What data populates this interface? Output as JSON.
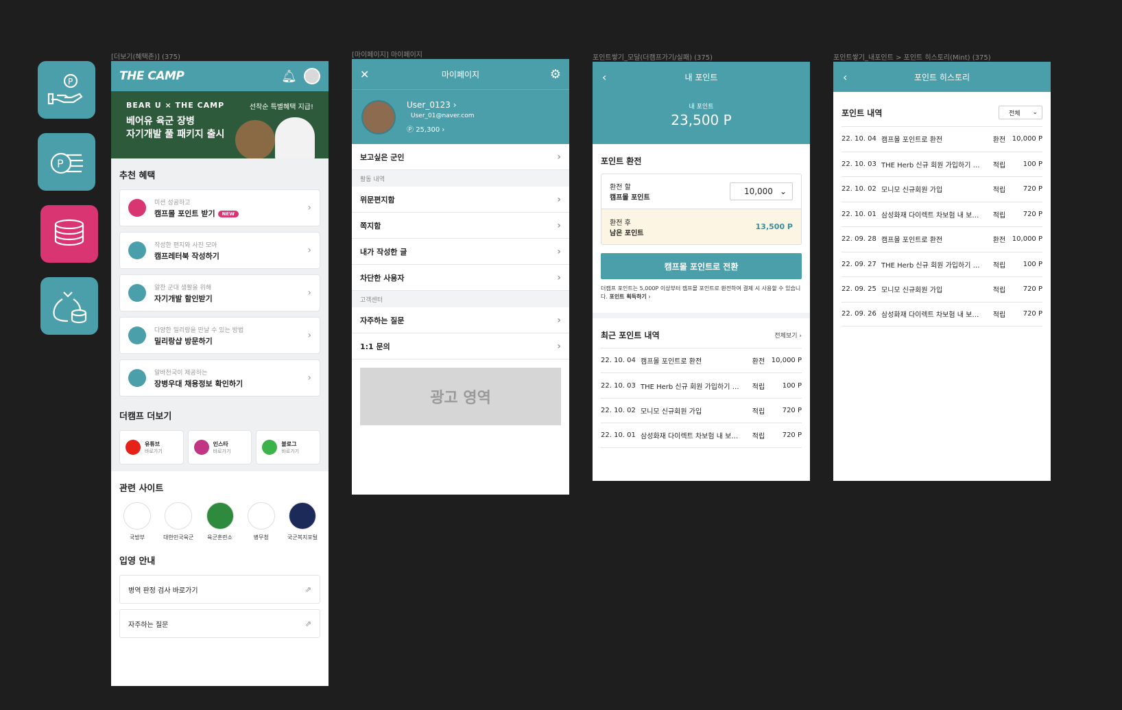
{
  "labels": {
    "s1": "[더보기(혜택존)] (375)",
    "s2": "[마이페이지] 마이페이지",
    "s3": "포인트쌓기_모달(더캠프가기/실패) (375)",
    "s4": "포인트쌓기_내포인트 > 포인트 히스토리(Mint) (375)"
  },
  "colors": {
    "teal": "#4a9fab",
    "pink": "#d93572",
    "bg": "#1e1e1e"
  },
  "tiles": [
    {
      "icon": "hand-point-icon",
      "color": "#4a9fab"
    },
    {
      "icon": "point-coins-icon",
      "color": "#4a9fab"
    },
    {
      "icon": "coin-stack-icon",
      "color": "#d93572"
    },
    {
      "icon": "money-bag-icon",
      "color": "#4a9fab"
    }
  ],
  "s1": {
    "logo": "THE CAMP",
    "banner": {
      "brand": "BEAR U × THE CAMP",
      "highlight": "선착순 특별혜택 지급!",
      "line1": "베어유 육군 장병",
      "line2": "자기개발 풀 패키지 출시"
    },
    "benefit_title": "추천 혜택",
    "benefits": [
      {
        "sub": "미션 성공하고",
        "main": "캠프몰 포인트 받기",
        "badge": "NEW"
      },
      {
        "sub": "작성한 편지와 사진 모아",
        "main": "캠프레터북 작성하기"
      },
      {
        "sub": "알찬 군대 생활을 위해",
        "main": "자기개발 할인받기"
      },
      {
        "sub": "다양한 밀리랑을 만날 수 있는 방법",
        "main": "밀리랑샵 방문하기"
      },
      {
        "sub": "알바천국이 제공하는",
        "main": "장병우대 채용정보 확인하기"
      }
    ],
    "more_title": "더캠프 더보기",
    "social": [
      {
        "name": "유튜브",
        "go": "바로가기",
        "color": "#e62117"
      },
      {
        "name": "인스타",
        "go": "바로가기",
        "color": "#c13584"
      },
      {
        "name": "블로그",
        "go": "바로가기",
        "color": "#3bb34a"
      }
    ],
    "sites_title": "관련 사이트",
    "sites": [
      {
        "name": "국방부",
        "color": "#ffffff"
      },
      {
        "name": "대한민국육군",
        "color": "#ffffff"
      },
      {
        "name": "육군훈련소",
        "color": "#2e8b3e"
      },
      {
        "name": "병무청",
        "color": "#ffffff"
      },
      {
        "name": "국군복지포털",
        "color": "#1c2a5a"
      }
    ],
    "enlist_title": "입영 안내",
    "links": [
      "병역 판정 검사 바로가기",
      "자주하는 질문"
    ]
  },
  "s2": {
    "title": "마이페이지",
    "user": "User_0123",
    "email": "User_01@naver.com",
    "points": "25,300",
    "menu_top": "보고싶은 군인",
    "group1": "활동 내역",
    "group1_items": [
      "위문편지함",
      "쪽지함",
      "내가 작성한 글",
      "차단한 사용자"
    ],
    "group2": "고객센터",
    "group2_items": [
      "자주하는 질문",
      "1:1 문의"
    ],
    "ad": "광고 영역"
  },
  "s3": {
    "title": "내 포인트",
    "my_label": "내 포인트",
    "my_value": "23,500 P",
    "exchange_title": "포인트 환전",
    "exchange_label1": "환전 할",
    "exchange_label2": "캠프몰 포인트",
    "exchange_value": "10,000",
    "remain_label1": "환전 후",
    "remain_label2": "남은 포인트",
    "remain_value": "13,500 P",
    "convert_button": "캠프몰 포인트로 전환",
    "note": "더캠프 포인트는 5,000P 이상부터 캠프몰 포인트로 환전하여 결제 시 사용할 수 있습니다.",
    "note_link": "포인트 획득하기",
    "recent_title": "최근 포인트 내역",
    "see_all": "전체보기",
    "history": [
      {
        "date": "22. 10. 04",
        "desc": "캠프몰 포인트로 환전",
        "type": "환전",
        "amount": "10,000 P"
      },
      {
        "date": "22. 10. 03",
        "desc": "THE Herb 신규 회원 가입하기 이벤트",
        "type": "적립",
        "amount": "100 P"
      },
      {
        "date": "22. 10. 02",
        "desc": "모니모 신규회원 가입",
        "type": "적립",
        "amount": "720 P"
      },
      {
        "date": "22. 10. 01",
        "desc": "삼성화재 다이렉트 차보험 내 보험료 확인",
        "type": "적립",
        "amount": "720 P"
      }
    ]
  },
  "s4": {
    "title": "포인트 히스토리",
    "list_title": "포인트 내역",
    "filter": "전체",
    "history": [
      {
        "date": "22. 10. 04",
        "desc": "캠프몰 포인트로 환전",
        "type": "환전",
        "amount": "10,000 P"
      },
      {
        "date": "22. 10. 03",
        "desc": "THE Herb 신규 회원 가입하기 이벤트",
        "type": "적립",
        "amount": "100 P"
      },
      {
        "date": "22. 10. 02",
        "desc": "모니모 신규회원 가입",
        "type": "적립",
        "amount": "720 P"
      },
      {
        "date": "22. 10. 01",
        "desc": "삼성화재 다이렉트 차보험 내 보험료 확인",
        "type": "적립",
        "amount": "720 P"
      },
      {
        "date": "22. 09. 28",
        "desc": "캠프몰 포인트로 환전",
        "type": "환전",
        "amount": "10,000 P"
      },
      {
        "date": "22. 09. 27",
        "desc": "THE Herb 신규 회원 가입하기 이벤트",
        "type": "적립",
        "amount": "100 P"
      },
      {
        "date": "22. 09. 25",
        "desc": "모니모 신규회원 가입",
        "type": "적립",
        "amount": "720 P"
      },
      {
        "date": "22. 09. 26",
        "desc": "삼성화재 다이렉트 차보험 내 보험료 확인",
        "type": "적립",
        "amount": "720 P"
      }
    ]
  }
}
